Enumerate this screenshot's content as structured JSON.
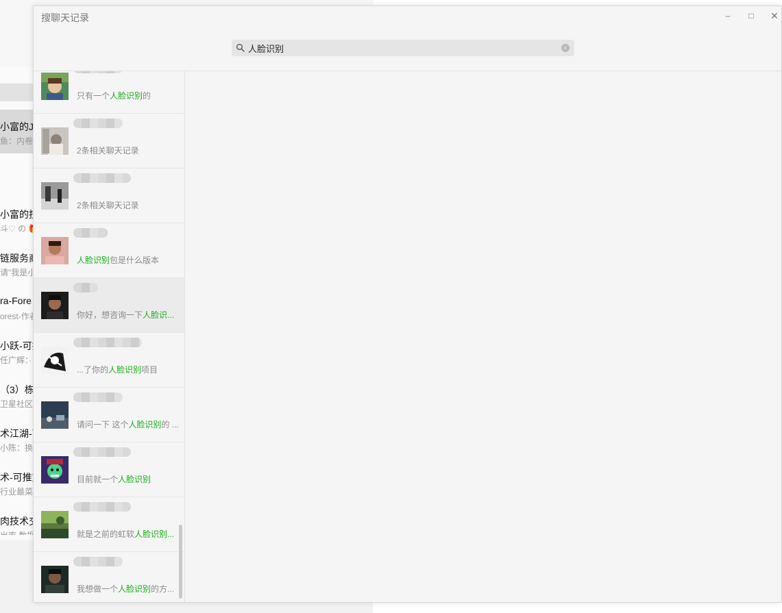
{
  "background_window": {
    "items": [
      {
        "title": "小富的Ja",
        "sub": "鱼：内卷的"
      },
      {
        "title": "小富的技",
        "sub": "斗♡ の 🎁"
      },
      {
        "title": "链服务商",
        "sub": "请\"我是小"
      },
      {
        "title": "ra-Fore",
        "sub": "orest-作者"
      },
      {
        "title": "小跃-可推",
        "sub": "任广辉：·"
      },
      {
        "title": "（3）栋",
        "sub": "卫星社区"
      },
      {
        "title": "术江湖-可",
        "sub": "小陈：换"
      },
      {
        "title": "术-可推文",
        "sub": "行业最菜"
      },
      {
        "title": "肉技术交",
        "sub": "出库 数据"
      }
    ]
  },
  "dialog": {
    "title": "搜聊天记录",
    "window_controls": {
      "minimize": "–",
      "maximize": "□",
      "close": "✕"
    },
    "search": {
      "value": "人脸识别",
      "clear_icon": "×"
    },
    "results": [
      {
        "pre": "只有一个",
        "hl": "人脸识别",
        "post": "的"
      },
      {
        "pre": "2条相关聊天记录",
        "hl": "",
        "post": ""
      },
      {
        "pre": "2条相关聊天记录",
        "hl": "",
        "post": ""
      },
      {
        "pre": "",
        "hl": "人脸识别",
        "post": "包是什么版本"
      },
      {
        "pre": "你好，想咨询一下",
        "hl": "人脸识...",
        "post": ""
      },
      {
        "pre": "...了你的",
        "hl": "人脸识别",
        "post": "项目"
      },
      {
        "pre": "请问一下 这个",
        "hl": "人脸识别",
        "post": "的 ..."
      },
      {
        "pre": "目前就一个",
        "hl": "人脸识别",
        "post": ""
      },
      {
        "pre": "就是之前的虹软",
        "hl": "人脸识别...",
        "post": ""
      },
      {
        "pre": "我想做一个",
        "hl": "人脸识别",
        "post": "的方..."
      }
    ]
  },
  "colors": {
    "highlight": "#1aad19",
    "snippet": "#8a8a8a"
  }
}
